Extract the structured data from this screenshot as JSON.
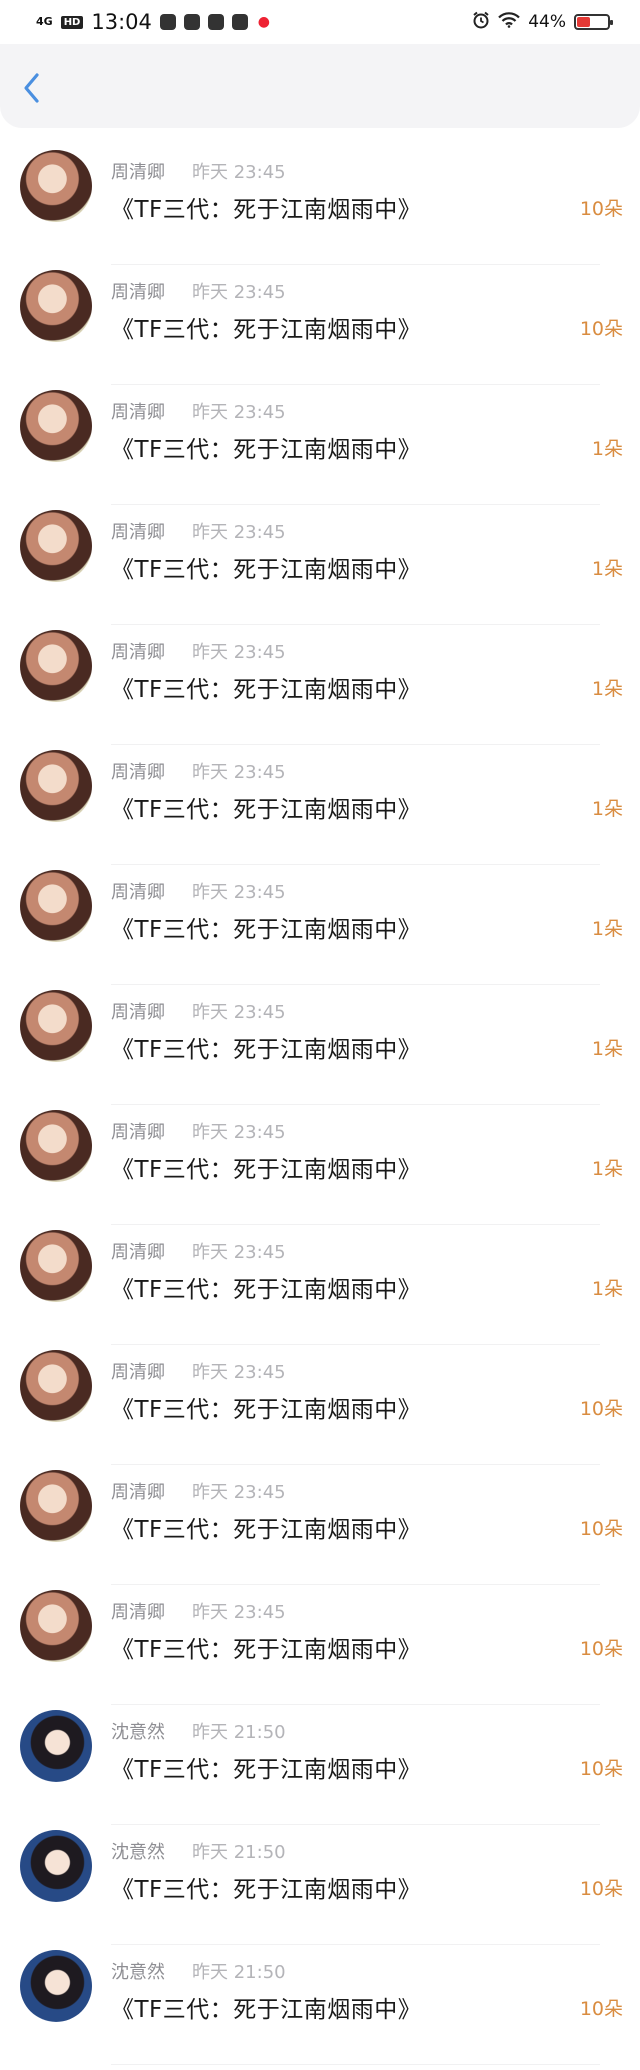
{
  "status_bar": {
    "signal": "4G",
    "hd": "HD",
    "time": "13:04",
    "battery_percent_label": "44%",
    "battery_level": 0.44
  },
  "nav": {
    "back_icon": "chevron-left-icon"
  },
  "colors": {
    "accent": "#4a8fe0",
    "gift": "#d98c40",
    "meta": "#8e8e93",
    "nav_bg": "#f4f4f6"
  },
  "items": [
    {
      "name": "周清卿",
      "time": "昨天 23:45",
      "title": "《TF三代：死于江南烟雨中》",
      "gift": "10朵",
      "avatar": "a"
    },
    {
      "name": "周清卿",
      "time": "昨天 23:45",
      "title": "《TF三代：死于江南烟雨中》",
      "gift": "10朵",
      "avatar": "a"
    },
    {
      "name": "周清卿",
      "time": "昨天 23:45",
      "title": "《TF三代：死于江南烟雨中》",
      "gift": "1朵",
      "avatar": "a"
    },
    {
      "name": "周清卿",
      "time": "昨天 23:45",
      "title": "《TF三代：死于江南烟雨中》",
      "gift": "1朵",
      "avatar": "a"
    },
    {
      "name": "周清卿",
      "time": "昨天 23:45",
      "title": "《TF三代：死于江南烟雨中》",
      "gift": "1朵",
      "avatar": "a"
    },
    {
      "name": "周清卿",
      "time": "昨天 23:45",
      "title": "《TF三代：死于江南烟雨中》",
      "gift": "1朵",
      "avatar": "a"
    },
    {
      "name": "周清卿",
      "time": "昨天 23:45",
      "title": "《TF三代：死于江南烟雨中》",
      "gift": "1朵",
      "avatar": "a"
    },
    {
      "name": "周清卿",
      "time": "昨天 23:45",
      "title": "《TF三代：死于江南烟雨中》",
      "gift": "1朵",
      "avatar": "a"
    },
    {
      "name": "周清卿",
      "time": "昨天 23:45",
      "title": "《TF三代：死于江南烟雨中》",
      "gift": "1朵",
      "avatar": "a"
    },
    {
      "name": "周清卿",
      "time": "昨天 23:45",
      "title": "《TF三代：死于江南烟雨中》",
      "gift": "1朵",
      "avatar": "a"
    },
    {
      "name": "周清卿",
      "time": "昨天 23:45",
      "title": "《TF三代：死于江南烟雨中》",
      "gift": "10朵",
      "avatar": "a"
    },
    {
      "name": "周清卿",
      "time": "昨天 23:45",
      "title": "《TF三代：死于江南烟雨中》",
      "gift": "10朵",
      "avatar": "a"
    },
    {
      "name": "周清卿",
      "time": "昨天 23:45",
      "title": "《TF三代：死于江南烟雨中》",
      "gift": "10朵",
      "avatar": "a"
    },
    {
      "name": "沈意然",
      "time": "昨天 21:50",
      "title": "《TF三代：死于江南烟雨中》",
      "gift": "10朵",
      "avatar": "b"
    },
    {
      "name": "沈意然",
      "time": "昨天 21:50",
      "title": "《TF三代：死于江南烟雨中》",
      "gift": "10朵",
      "avatar": "b"
    },
    {
      "name": "沈意然",
      "time": "昨天 21:50",
      "title": "《TF三代：死于江南烟雨中》",
      "gift": "10朵",
      "avatar": "b"
    }
  ]
}
